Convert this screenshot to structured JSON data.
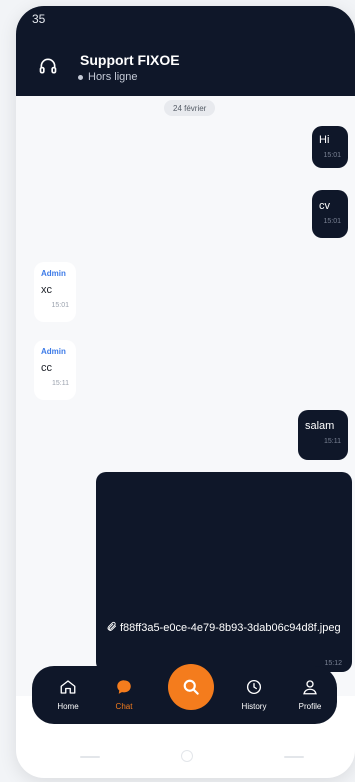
{
  "status_time": "35",
  "header": {
    "title": "Support FIXOE",
    "status": "Hors ligne"
  },
  "date_separator": "24 février",
  "messages": [
    {
      "text": "Hi",
      "time": "15:01"
    },
    {
      "text": "cv",
      "time": "15:01"
    },
    {
      "author": "Admin",
      "text": "xc",
      "time": "15:01"
    },
    {
      "author": "Admin",
      "text": "cc",
      "time": "15:11"
    },
    {
      "text": "salam",
      "time": "15:11"
    },
    {
      "attachment": "f88ff3a5-e0ce-4e79-8b93-3dab06c94d8f.jpeg",
      "time": "15:12"
    }
  ],
  "nav": {
    "home": "Home",
    "chat": "Chat",
    "history": "History",
    "profile": "Profile"
  },
  "colors": {
    "accent": "#f47c1d",
    "dark": "#0f1729",
    "link": "#3d7be8"
  }
}
